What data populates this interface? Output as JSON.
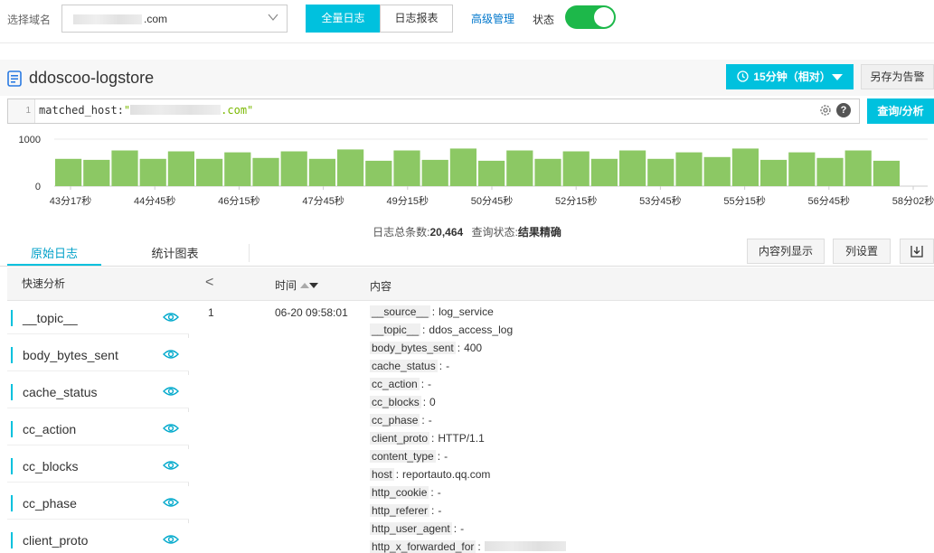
{
  "topbar": {
    "domain_label": "选择域名",
    "domain_value": ".com",
    "btn_all_logs": "全量日志",
    "btn_log_report": "日志报表",
    "link_advanced": "高级管理",
    "status_label": "状态",
    "status_on": true
  },
  "logstore": {
    "title": "ddoscoo-logstore",
    "time_range": "15分钟（相对）",
    "save_alert": "另存为告警"
  },
  "query": {
    "line_no": "1",
    "prefix": "matched_host:",
    "quote_open": "\"",
    "quote_close": ".com\"",
    "submit": "查询/分析",
    "help": "?"
  },
  "chart_data": {
    "type": "bar",
    "y_ticks": [
      "1000",
      "0"
    ],
    "ylim": [
      0,
      1000
    ],
    "x_ticks": [
      "43分17秒",
      "44分45秒",
      "46分15秒",
      "47分45秒",
      "49分15秒",
      "50分45秒",
      "52分15秒",
      "53分45秒",
      "55分15秒",
      "56分45秒",
      "58分02秒"
    ],
    "values": [
      580,
      560,
      760,
      580,
      740,
      580,
      720,
      600,
      740,
      580,
      780,
      540,
      760,
      560,
      800,
      540,
      760,
      580,
      740,
      580,
      760,
      580,
      720,
      620,
      800,
      560,
      720,
      600,
      760,
      540
    ],
    "bar_color": "#8cc864",
    "grid": true
  },
  "summary": {
    "total_label": "日志总条数:",
    "total_value": "20,464",
    "status_label": "查询状态:",
    "status_value": "结果精确"
  },
  "tabs": {
    "raw": "原始日志",
    "chart": "统计图表",
    "btn_show_cols": "内容列显示",
    "btn_col_settings": "列设置"
  },
  "sidebar": {
    "header": "快速分析",
    "items": [
      "__topic__",
      "body_bytes_sent",
      "cache_status",
      "cc_action",
      "cc_blocks",
      "cc_phase",
      "client_proto"
    ]
  },
  "table": {
    "back": "<",
    "col_time": "时间",
    "col_content": "内容",
    "row": {
      "index": "1",
      "time": "06-20 09:58:01",
      "fields": [
        {
          "k": "__source__",
          "v": "log_service"
        },
        {
          "k": "__topic__",
          "v": "ddos_access_log"
        },
        {
          "k": "body_bytes_sent",
          "v": "400"
        },
        {
          "k": "cache_status",
          "v": "-"
        },
        {
          "k": "cc_action",
          "v": "-"
        },
        {
          "k": "cc_blocks",
          "v": "0"
        },
        {
          "k": "cc_phase",
          "v": "-"
        },
        {
          "k": "client_proto",
          "v": "HTTP/1.1"
        },
        {
          "k": "content_type",
          "v": "-"
        },
        {
          "k": "host",
          "v": "reportauto.qq.com"
        },
        {
          "k": "http_cookie",
          "v": "-"
        },
        {
          "k": "http_referer",
          "v": "-"
        },
        {
          "k": "http_user_agent",
          "v": "-"
        },
        {
          "k": "http_x_forwarded_for",
          "v": ""
        }
      ]
    }
  },
  "colors": {
    "accent": "#00c1de",
    "toggle_on": "#1db84a",
    "link": "#0077cc",
    "query_string": "#7ab800"
  }
}
